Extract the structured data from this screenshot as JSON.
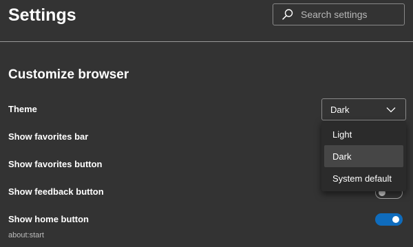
{
  "header": {
    "title": "Settings",
    "search": {
      "placeholder": "Search settings",
      "value": "",
      "icon": "search-icon"
    }
  },
  "section": {
    "title": "Customize browser"
  },
  "settings": {
    "theme": {
      "label": "Theme",
      "selected": "Dark",
      "options": [
        "Light",
        "Dark",
        "System default"
      ],
      "dropdown_open": true
    },
    "favorites_bar": {
      "label": "Show favorites bar"
    },
    "favorites_button": {
      "label": "Show favorites button"
    },
    "feedback_button": {
      "label": "Show feedback button",
      "enabled": false
    },
    "home_button": {
      "label": "Show home button",
      "sublabel": "about:start",
      "enabled": true
    }
  },
  "colors": {
    "background": "#333333",
    "accent": "#0f6cbd",
    "dropdown_background": "#2b2b2b",
    "selected_option": "#464646"
  }
}
